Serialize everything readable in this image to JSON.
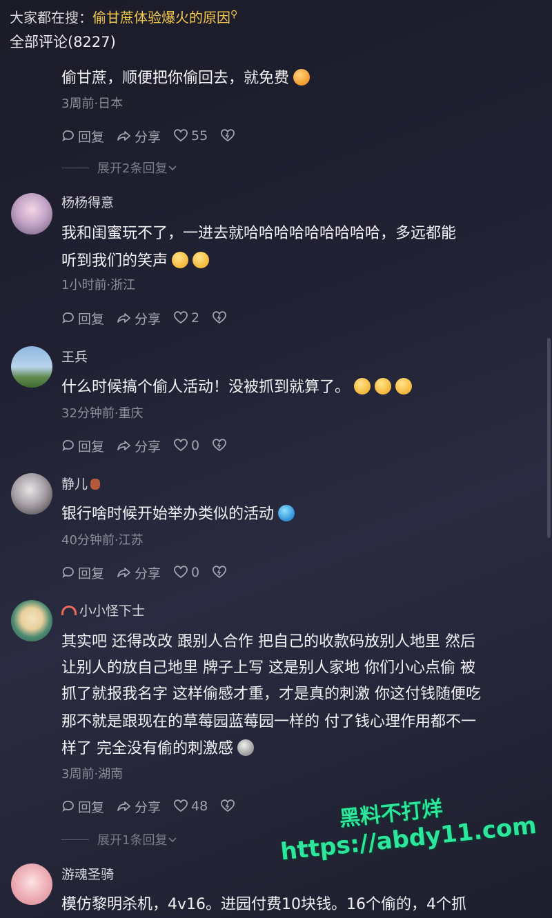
{
  "header": {
    "search_prefix": "大家都在搜：",
    "search_query": "偷甘蔗体验爆火的原因",
    "comment_count_label": "全部评论(8227)"
  },
  "labels": {
    "reply": "回复",
    "share": "分享"
  },
  "comments": [
    {
      "username": "",
      "lines": [
        "偷甘蔗，顺便把你偷回去，就免费"
      ],
      "meta": "3周前·日本",
      "likes": "55",
      "expand": "展开2条回复"
    },
    {
      "username": "杨杨得意",
      "lines": [
        "我和闺蜜玩不了，一进去就哈哈哈哈哈哈哈哈哈，多远都能",
        "听到我们的笑声"
      ],
      "meta": "1小时前·浙江",
      "likes": "2"
    },
    {
      "username": "王兵",
      "lines": [
        "什么时候搞个偷人活动！没被抓到就算了。"
      ],
      "meta": "32分钟前·重庆",
      "likes": "0"
    },
    {
      "username": "静儿",
      "lines": [
        "银行啥时候开始举办类似的活动"
      ],
      "meta": "40分钟前·江苏",
      "likes": "0"
    },
    {
      "username": "小小怪下士",
      "lines": [
        "其实吧 还得改改 跟别人合作 把自己的收款码放别人地里 然后",
        "让别人的放自己地里 牌子上写 这是别人家地 你们小心点偷 被",
        "抓了就报我名字 这样偷感才重，才是真的刺激 你这付钱随便吃",
        "那不就是跟现在的草莓园蓝莓园一样的 付了钱心理作用都不一",
        "样了 完全没有偷的刺激感"
      ],
      "meta": "3周前·湖南",
      "likes": "48",
      "expand": "展开1条回复"
    },
    {
      "username": "游魂圣骑",
      "lines": [
        "模仿黎明杀机，4v16。进园付费10块钱。16个偷的，4个抓"
      ]
    }
  ],
  "watermark": {
    "line1": "黑料不打烊",
    "line2": "https://abdy11.com"
  },
  "icons": [
    "search-icon",
    "reply-icon",
    "share-icon",
    "heart-icon",
    "dislike-icon",
    "chevron-down-icon"
  ],
  "colors": {
    "accent": "#f3c84b",
    "watermark": "#2ee59d"
  }
}
